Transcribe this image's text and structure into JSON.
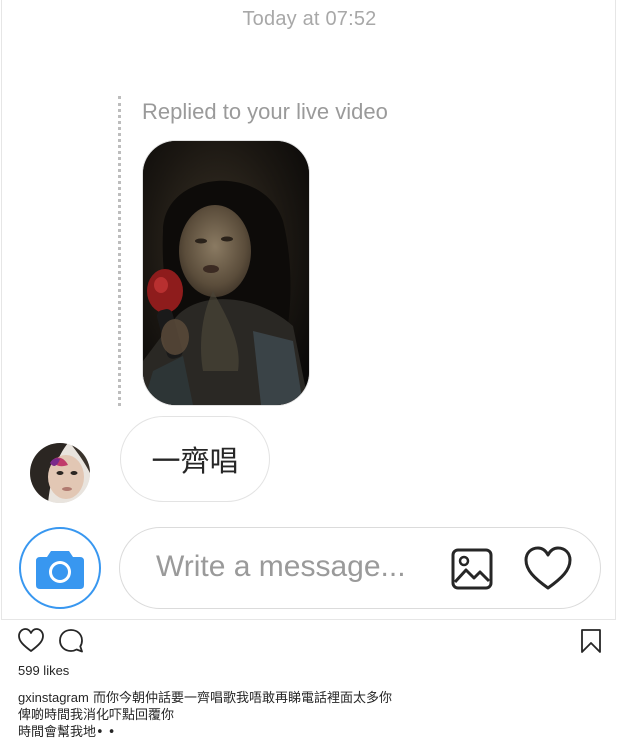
{
  "thread": {
    "timestamp": "Today at 07:52",
    "reply_caption": "Replied to your live video",
    "message_text": "一齊唱"
  },
  "composer": {
    "placeholder": "Write a message...",
    "icons": {
      "camera": "camera-icon",
      "gallery": "gallery-icon",
      "heart": "heart-icon"
    },
    "accent_color": "#3897f0"
  },
  "post": {
    "likes": "599 likes",
    "username": "gxinstagram",
    "caption_lines": [
      "而你今朝仲話要一齊唱歌我唔敢再睇電話裡面太多你",
      "俾啲時間我消化吓點回覆你",
      "時間會幫我地• •"
    ],
    "icons": {
      "like": "heart-outline-icon",
      "comment": "comment-icon",
      "save": "bookmark-icon"
    }
  }
}
